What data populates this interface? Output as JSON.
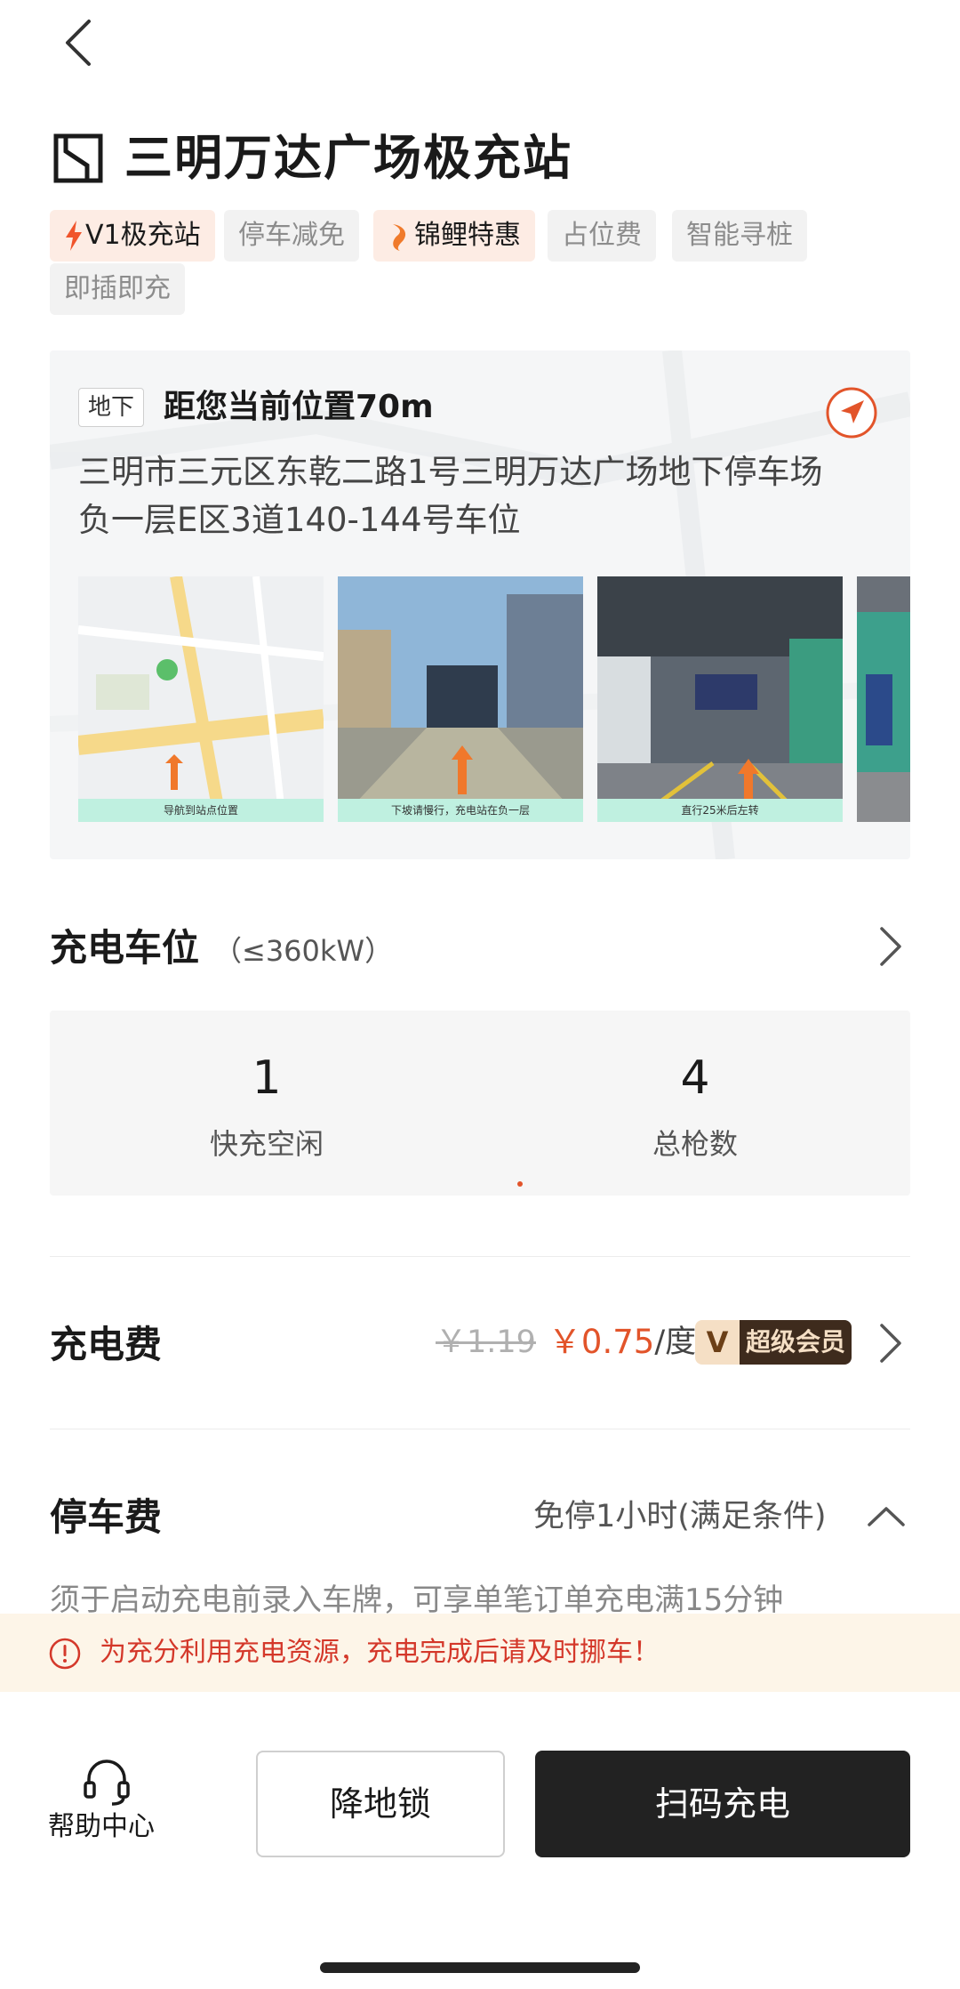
{
  "station": {
    "title": "三明万达广场极充站",
    "tags": [
      {
        "label": "V1极充站",
        "highlight": true,
        "icon": "lightning-icon"
      },
      {
        "label": "停车减免",
        "highlight": false
      },
      {
        "label": "锦鲤特惠",
        "highlight": true,
        "icon": "koi-icon"
      },
      {
        "label": "占位费",
        "highlight": false
      },
      {
        "label": "智能寻桩",
        "highlight": false
      },
      {
        "label": "即插即充",
        "highlight": false
      }
    ]
  },
  "location": {
    "level": "地下",
    "distance": "距您当前位置70m",
    "address": "三明市三元区东乾二路1号三明万达广场地下停车场负一层E区3道140-144号车位",
    "photos": [
      {
        "caption": "导航到站点位置"
      },
      {
        "caption": "下坡请慢行，充电站在负一层"
      },
      {
        "caption": "直行25米后左转"
      },
      {
        "caption": ""
      }
    ]
  },
  "slots": {
    "title": "充电车位",
    "power": "（≤360kW）",
    "fast_free": "1",
    "fast_free_label": "快充空闲",
    "total": "4",
    "total_label": "总枪数"
  },
  "fee": {
    "title": "充电费",
    "old_price": "￥1.19",
    "new_price": "￥0.75",
    "unit": "/度",
    "vip_letter": "V",
    "vip_label": "超级会员"
  },
  "parking": {
    "title": "停车费",
    "summary": "免停1小时(满足条件)",
    "detail": "须于启动充电前录入车牌，可享单笔订单充电满15分钟"
  },
  "notice": {
    "text": "为充分利用充电资源，充电完成后请及时挪车！"
  },
  "bottom": {
    "help": "帮助中心",
    "lock": "降地锁",
    "scan": "扫码充电"
  },
  "colors": {
    "accent": "#e2542a",
    "notice_bg": "#fdf5e8",
    "notice_text": "#d4382a",
    "primary_btn": "#222222"
  }
}
